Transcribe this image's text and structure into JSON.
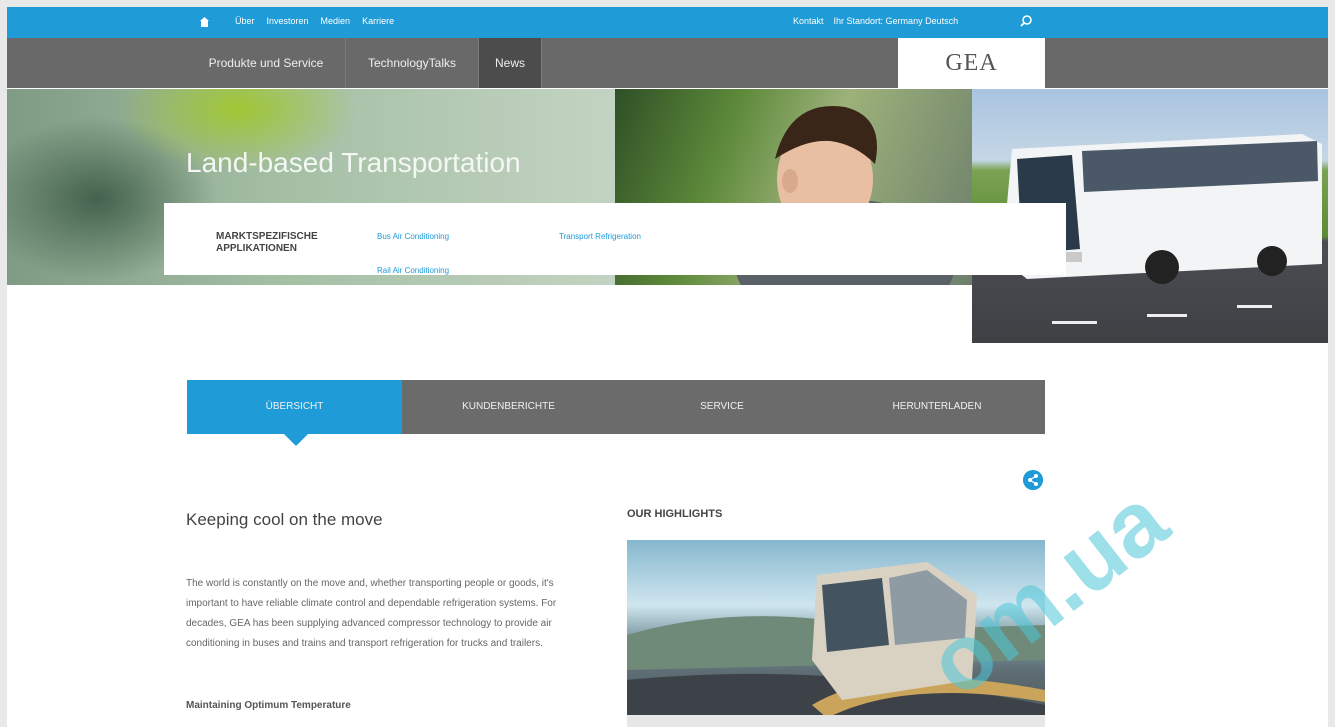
{
  "topbar": {
    "links": [
      "Über",
      "Investoren",
      "Medien",
      "Karriere"
    ],
    "right_links": [
      "Kontakt",
      "Ihr Standort: Germany Deutsch"
    ]
  },
  "nav": {
    "items": [
      {
        "label": "Produkte und Service"
      },
      {
        "label": "TechnologyTalks"
      },
      {
        "label": "News"
      }
    ],
    "logo": "GEA"
  },
  "hero": {
    "title": "Land-based Transportation"
  },
  "market": {
    "title": "MARKTSPEZIFISCHE APPLIKATIONEN",
    "links": [
      "Bus Air Conditioning",
      "Transport Refrigeration",
      "Rail Air Conditioning"
    ]
  },
  "tabs": [
    "ÜBERSICHT",
    "KUNDENBERICHTE",
    "SERVICE",
    "HERUNTERLADEN"
  ],
  "content": {
    "title": "Keeping cool on the move",
    "text": "The world is constantly on the move and, whether transporting people or goods, it's important to have reliable climate control and dependable refrigeration systems. For decades, GEA has been supplying advanced compressor technology to provide air conditioning in buses and trains and transport refrigeration for trucks and trailers.",
    "subheading": "Maintaining Optimum Temperature"
  },
  "highlights": {
    "title": "OUR HIGHLIGHTS"
  },
  "watermark": "om.ua",
  "colors": {
    "accent": "#1f9bd7",
    "nav": "#696969",
    "nav_active": "#4c4c4c"
  }
}
